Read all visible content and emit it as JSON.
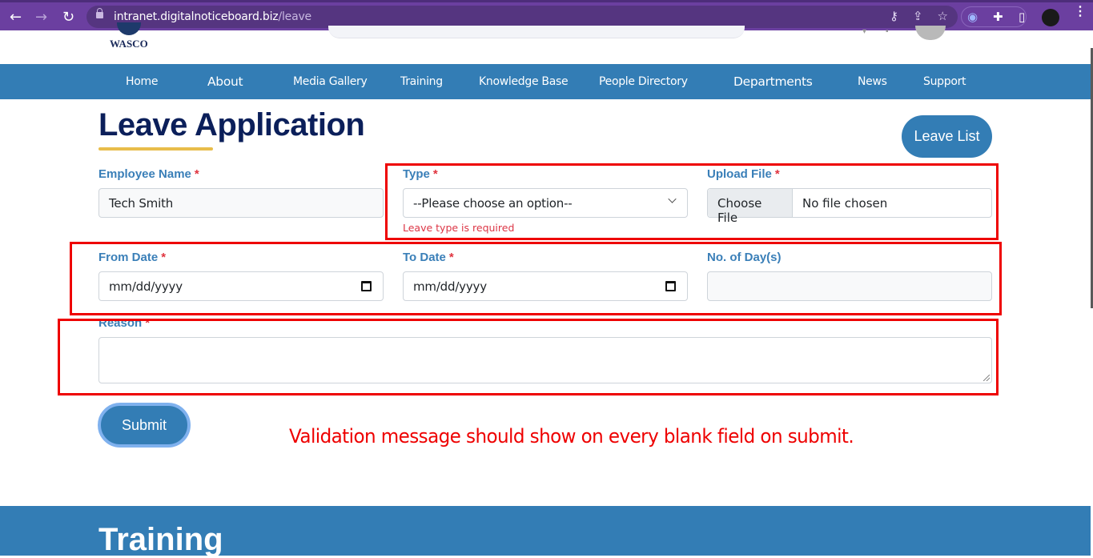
{
  "browser": {
    "url_host": "intranet.digitalnoticeboard.biz",
    "url_path": "/leave",
    "icons": [
      "back-icon",
      "forward-icon",
      "reload-icon",
      "lock-icon",
      "key-icon",
      "share-icon",
      "star-icon",
      "screen-capture-icon",
      "extensions-icon",
      "sidepanel-icon",
      "profile-avatar",
      "more-menu-icon"
    ]
  },
  "header": {
    "logo_text": "WASCO"
  },
  "nav": {
    "items": [
      {
        "label": "Home"
      },
      {
        "label": "About"
      },
      {
        "label": "Media Gallery"
      },
      {
        "label": "Training"
      },
      {
        "label": "Knowledge Base"
      },
      {
        "label": "People Directory"
      },
      {
        "label": "Departments"
      },
      {
        "label": "News"
      },
      {
        "label": "Support"
      }
    ]
  },
  "page": {
    "title": "Leave Application",
    "leave_list_button": "Leave List",
    "accent_underline_color": "#e8bd4a"
  },
  "form": {
    "employee_name": {
      "label": "Employee Name",
      "required": "*",
      "value": "Tech  Smith"
    },
    "type": {
      "label": "Type",
      "required": "*",
      "selected": "--Please choose an option--",
      "error": "Leave type is required"
    },
    "upload_file": {
      "label": "Upload File",
      "required": "*",
      "button": "Choose File",
      "status": "No file chosen"
    },
    "from_date": {
      "label": "From Date",
      "required": "*",
      "placeholder": "mm/dd/yyyy"
    },
    "to_date": {
      "label": "To Date",
      "required": "*",
      "placeholder": "mm/dd/yyyy"
    },
    "days": {
      "label": "No. of Day(s)",
      "value": ""
    },
    "reason": {
      "label": "Reason",
      "required": "*",
      "value": ""
    },
    "submit": "Submit"
  },
  "annotation": {
    "note": "Validation message should show on every blank field on submit.",
    "color": "#ee0000"
  },
  "footer": {
    "section_title": "Training"
  }
}
